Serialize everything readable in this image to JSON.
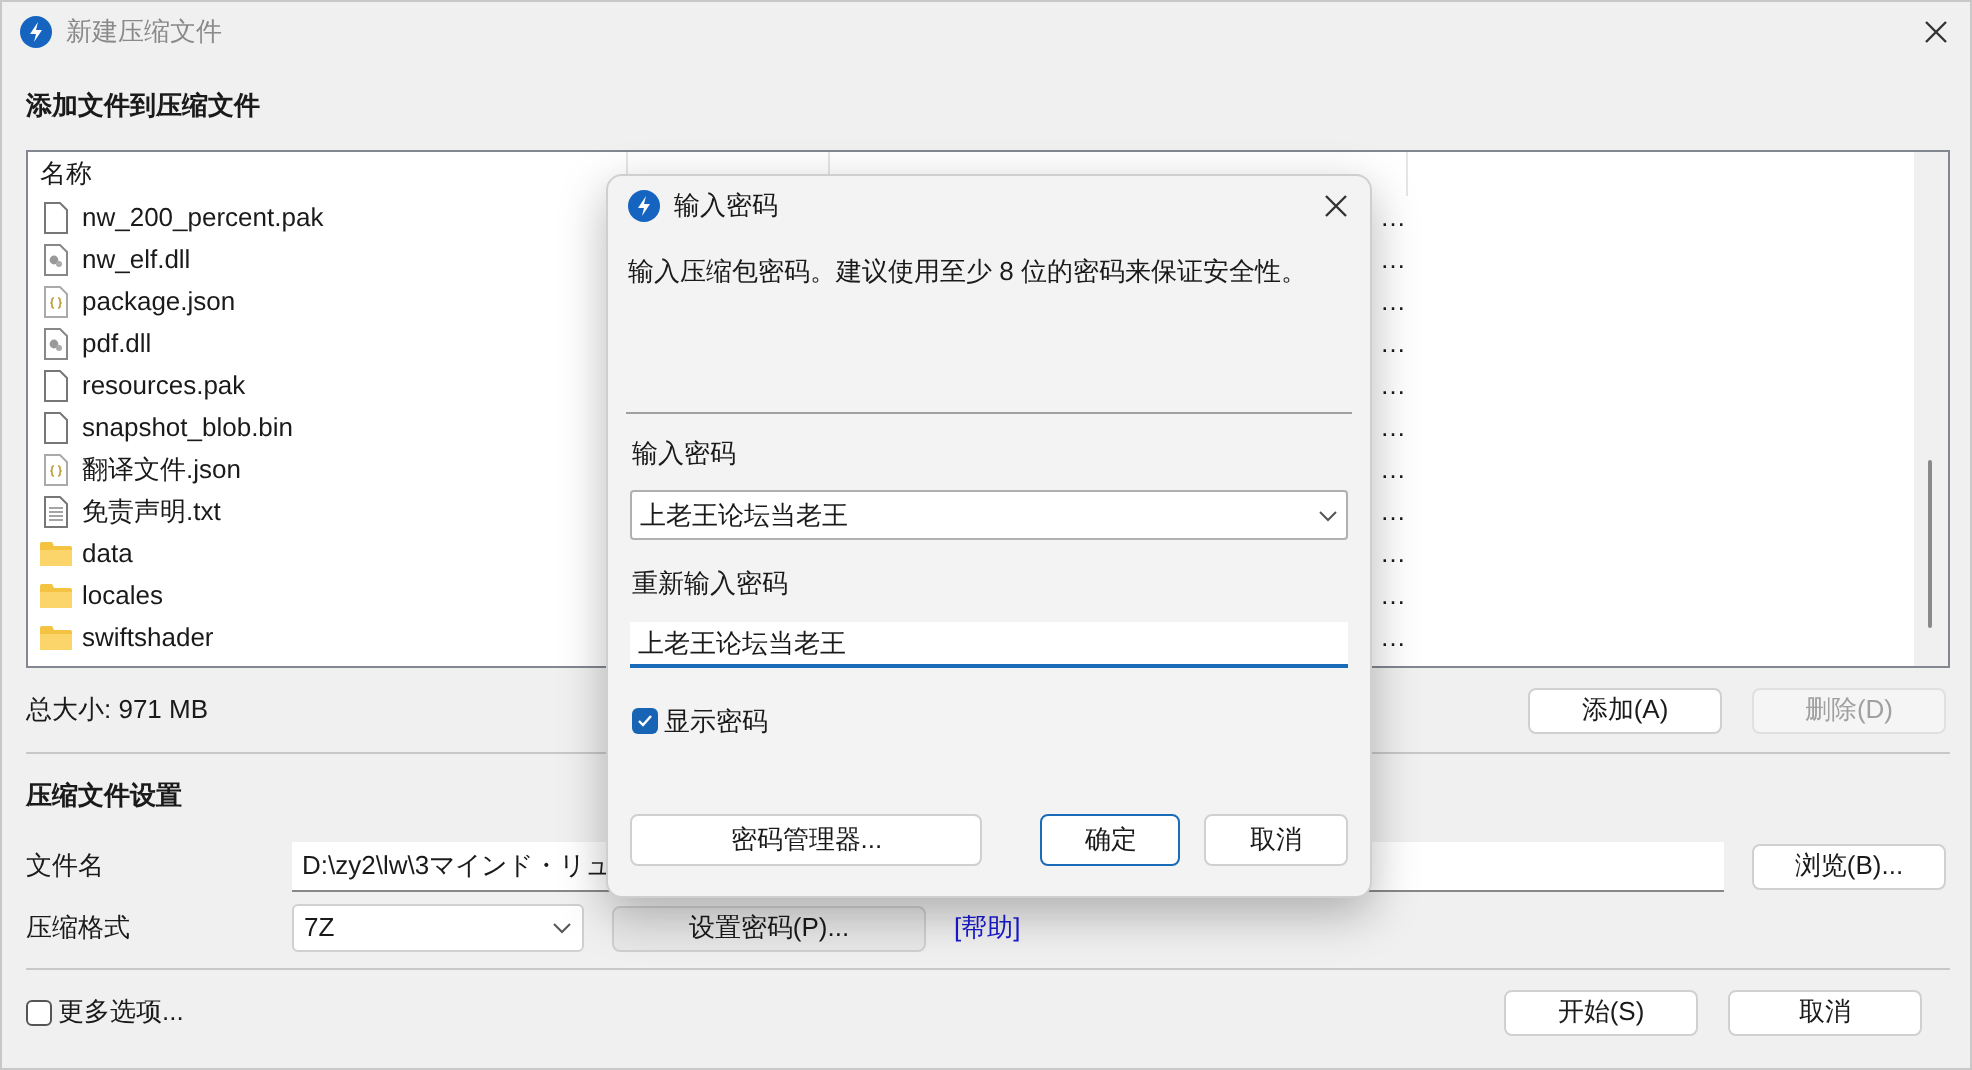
{
  "window": {
    "title": "新建压缩文件"
  },
  "add_section": {
    "heading": "添加文件到压缩文件"
  },
  "file_list": {
    "columns": [
      "名称"
    ],
    "rows": [
      {
        "kind": "blank",
        "name": "nw_200_percent.pak",
        "path": "…"
      },
      {
        "kind": "dll",
        "name": "nw_elf.dll",
        "path": "…"
      },
      {
        "kind": "json",
        "name": "package.json",
        "path": "…"
      },
      {
        "kind": "dll",
        "name": "pdf.dll",
        "path": "…"
      },
      {
        "kind": "blank",
        "name": "resources.pak",
        "path": "…"
      },
      {
        "kind": "blank",
        "name": "snapshot_blob.bin",
        "path": "…"
      },
      {
        "kind": "json",
        "name": "翻译文件.json",
        "path": "…"
      },
      {
        "kind": "txt",
        "name": "免责声明.txt",
        "path": "…"
      },
      {
        "kind": "folder",
        "name": "data",
        "path": "…"
      },
      {
        "kind": "folder",
        "name": "locales",
        "path": "…"
      },
      {
        "kind": "folder",
        "name": "swiftshader",
        "path": "…"
      }
    ]
  },
  "total_size": "总大小: 971 MB",
  "list_buttons": [
    {
      "label": "添加(A)",
      "disabled": false
    },
    {
      "label": "删除(D)",
      "disabled": true
    }
  ],
  "settings": {
    "heading": "压缩文件设置",
    "filename_label": "文件名",
    "filename": "D:\\zy2\\lw\\3マインド・リュ",
    "browse": "浏览(B)...",
    "format_label": "压缩格式",
    "format": "7Z",
    "set_password": "设置密码(P)...",
    "help_link": "[帮助]"
  },
  "more_options": {
    "label": "更多选项...",
    "checked": false
  },
  "footer_buttons": [
    "开始(S)",
    "取消"
  ],
  "dialog": {
    "title": "输入密码",
    "message": "输入压缩包密码。建议使用至少 8 位的密码来保证安全性。",
    "password_label": "输入密码",
    "password": "上老王论坛当老王",
    "confirm_label": "重新输入密码",
    "confirm": "上老王论坛当老王",
    "show_password": {
      "label": "显示密码",
      "checked": true
    },
    "buttons": [
      "密码管理器...",
      "确定",
      "取消"
    ]
  }
}
